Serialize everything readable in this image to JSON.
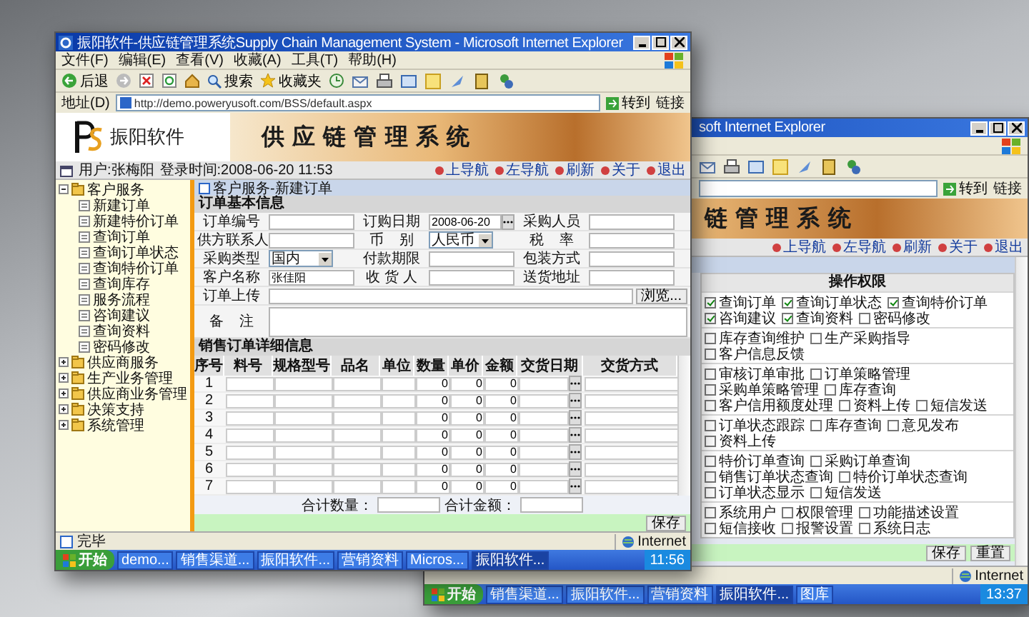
{
  "back_window": {
    "title": "soft Internet Explorer",
    "address": {
      "go": "转到",
      "links": "链接"
    },
    "header": {
      "system_title": "链 管 理 系 统"
    },
    "nav_links": [
      "上导航",
      "左导航",
      "刷新",
      "关于",
      "退出"
    ],
    "permissions": {
      "title": "操作权限",
      "groups": [
        [
          {
            "label": "查询订单",
            "checked": true
          },
          {
            "label": "查询订单状态",
            "checked": true
          },
          {
            "label": "查询特价订单",
            "checked": true
          },
          {
            "label": "咨询建议",
            "checked": true
          },
          {
            "label": "查询资料",
            "checked": true
          },
          {
            "label": "密码修改",
            "checked": false
          }
        ],
        [
          {
            "label": "库存查询维护",
            "checked": false
          },
          {
            "label": "生产采购指导",
            "checked": false
          },
          {
            "label": "客户信息反馈",
            "checked": false
          }
        ],
        [
          {
            "label": "审核订单审批",
            "checked": false
          },
          {
            "label": "订单策略管理",
            "checked": false
          },
          {
            "label": "采购单策略管理",
            "checked": false
          },
          {
            "label": "库存查询",
            "checked": false
          },
          {
            "label": "客户信用额度处理",
            "checked": false
          },
          {
            "label": "资料上传",
            "checked": false
          },
          {
            "label": "短信发送",
            "checked": false
          }
        ],
        [
          {
            "label": "订单状态跟踪",
            "checked": false
          },
          {
            "label": "库存查询",
            "checked": false
          },
          {
            "label": "意见发布",
            "checked": false
          },
          {
            "label": "资料上传",
            "checked": false
          }
        ],
        [
          {
            "label": "特价订单查询",
            "checked": false
          },
          {
            "label": "采购订单查询",
            "checked": false
          },
          {
            "label": "销售订单状态查询",
            "checked": false
          },
          {
            "label": "特价订单状态查询",
            "checked": false
          },
          {
            "label": "订单状态显示",
            "checked": false
          },
          {
            "label": "短信发送",
            "checked": false
          }
        ],
        [
          {
            "label": "系统用户",
            "checked": false
          },
          {
            "label": "权限管理",
            "checked": false
          },
          {
            "label": "功能描述设置",
            "checked": false
          },
          {
            "label": "短信接收",
            "checked": false
          },
          {
            "label": "报警设置",
            "checked": false
          },
          {
            "label": "系统日志",
            "checked": false
          }
        ]
      ]
    },
    "buttons": [
      "保存",
      "重置"
    ],
    "status_bar": {
      "zone": "Internet"
    },
    "taskbar": {
      "start": "开始",
      "tasks": [
        {
          "label": "销售渠道...",
          "selected": false
        },
        {
          "label": "振阳软件...",
          "selected": false
        },
        {
          "label": "营销资料",
          "selected": false
        },
        {
          "label": "振阳软件...",
          "selected": true
        },
        {
          "label": "图库",
          "selected": false
        }
      ],
      "clock": "13:37"
    }
  },
  "front_window": {
    "title": "振阳软件-供应链管理系统Supply Chain Management System - Microsoft Internet Explorer",
    "menu": [
      "文件(F)",
      "编辑(E)",
      "查看(V)",
      "收藏(A)",
      "工具(T)",
      "帮助(H)"
    ],
    "toolbar": {
      "back": "后退",
      "search": "搜索",
      "favorites": "收藏夹"
    },
    "address": {
      "label": "地址(D)",
      "url": "http://demo.poweryusoft.com/BSS/default.aspx",
      "go": "转到",
      "links": "链接"
    },
    "header": {
      "company": "振阳软件",
      "system_title": "供 应 链 管 理 系 统"
    },
    "user_bar": {
      "user": "用户:张梅阳",
      "login": "登录时间:2008-06-20 11:53"
    },
    "nav_links": [
      "上导航",
      "左导航",
      "刷新",
      "关于",
      "退出"
    ],
    "tree": [
      {
        "label": "客户服务",
        "expanded": true,
        "children": [
          {
            "label": "新建订单"
          },
          {
            "label": "新建特价订单"
          },
          {
            "label": "查询订单"
          },
          {
            "label": "查询订单状态"
          },
          {
            "label": "查询特价订单"
          },
          {
            "label": "查询库存"
          },
          {
            "label": "服务流程"
          },
          {
            "label": "咨询建议"
          },
          {
            "label": "查询资料"
          },
          {
            "label": "密码修改"
          }
        ]
      },
      {
        "label": "供应商服务",
        "expanded": false
      },
      {
        "label": "生产业务管理",
        "expanded": false
      },
      {
        "label": "供应商业务管理",
        "expanded": false
      },
      {
        "label": "决策支持",
        "expanded": false
      },
      {
        "label": "系统管理",
        "expanded": false
      }
    ],
    "breadcrumb": "客户服务-新建订单",
    "order_form": {
      "title": "订单基本信息",
      "rows": [
        [
          {
            "label": "订单编号",
            "kind": "text"
          },
          {
            "label": "订购日期",
            "kind": "date",
            "value": "2008-06-20"
          },
          {
            "label": "采购人员",
            "kind": "text"
          }
        ],
        [
          {
            "label": "供方联系人",
            "kind": "text"
          },
          {
            "label": "币    别",
            "kind": "select",
            "value": "人民币"
          },
          {
            "label": "税    率",
            "kind": "text"
          }
        ],
        [
          {
            "label": "采购类型",
            "kind": "select",
            "value": "国内"
          },
          {
            "label": "付款期限",
            "kind": "text"
          },
          {
            "label": "包装方式",
            "kind": "text"
          }
        ],
        [
          {
            "label": "客户名称",
            "kind": "text",
            "value": "张佳阳"
          },
          {
            "label": "收 货 人",
            "kind": "text"
          },
          {
            "label": "送货地址",
            "kind": "text"
          }
        ]
      ],
      "upload": {
        "label": "订单上传",
        "button": "浏览..."
      },
      "remarks": {
        "label": "备    注"
      }
    },
    "detail": {
      "title": "销售订单详细信息",
      "columns": [
        "序号",
        "料号",
        "规格型号",
        "品名",
        "单位",
        "数量",
        "单价",
        "金额",
        "交货日期",
        "交货方式"
      ],
      "rows": [
        {
          "no": "1",
          "quantity": "0",
          "price": "0",
          "amount": "0"
        },
        {
          "no": "2",
          "quantity": "0",
          "price": "0",
          "amount": "0"
        },
        {
          "no": "3",
          "quantity": "0",
          "price": "0",
          "amount": "0"
        },
        {
          "no": "4",
          "quantity": "0",
          "price": "0",
          "amount": "0"
        },
        {
          "no": "5",
          "quantity": "0",
          "price": "0",
          "amount": "0"
        },
        {
          "no": "6",
          "quantity": "0",
          "price": "0",
          "amount": "0"
        },
        {
          "no": "7",
          "quantity": "0",
          "price": "0",
          "amount": "0"
        }
      ],
      "total_quantity": "合计数量：",
      "total_amount": "合计金额："
    },
    "save_button": "保存",
    "status_bar": {
      "text": "完毕",
      "zone": "Internet"
    },
    "taskbar": {
      "start": "开始",
      "tasks": [
        {
          "label": "demo...",
          "selected": false
        },
        {
          "label": "销售渠道...",
          "selected": false
        },
        {
          "label": "振阳软件...",
          "selected": false
        },
        {
          "label": "营销资料",
          "selected": false
        },
        {
          "label": "Micros...",
          "selected": false
        },
        {
          "label": "振阳软件...",
          "selected": true
        }
      ],
      "clock": "11:56"
    }
  }
}
